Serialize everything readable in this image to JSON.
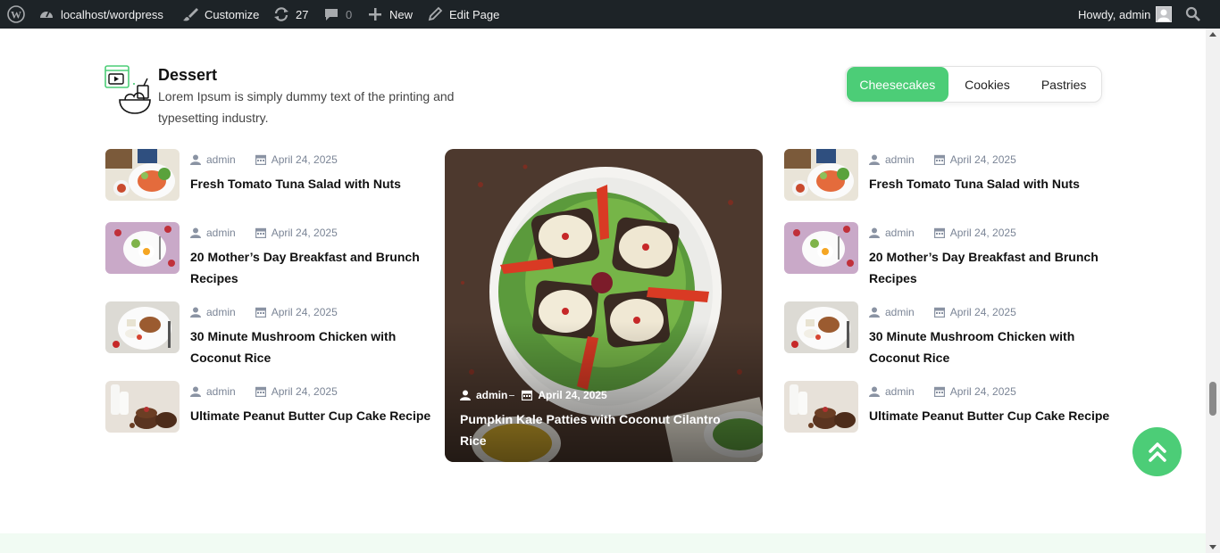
{
  "adminbar": {
    "site": "localhost/wordpress",
    "customize": "Customize",
    "updates": "27",
    "comments": "0",
    "new": "New",
    "edit_page": "Edit Page",
    "howdy": "Howdy, admin"
  },
  "section": {
    "title": "Dessert",
    "description": "Lorem Ipsum is simply dummy text of the printing and typesetting industry."
  },
  "tabs": [
    "Cheesecakes",
    "Cookies",
    "Pastries"
  ],
  "left_posts": [
    {
      "author": "admin",
      "date": "April 24, 2025",
      "title": "Fresh Tomato Tuna Salad with Nuts"
    },
    {
      "author": "admin",
      "date": "April 24, 2025",
      "title": "20 Mother’s Day Breakfast and Brunch Recipes"
    },
    {
      "author": "admin",
      "date": "April 24, 2025",
      "title": "30 Minute Mushroom Chicken with Coconut Rice"
    },
    {
      "author": "admin",
      "date": "April 24, 2025",
      "title": "Ultimate Peanut Butter Cup Cake Recipe"
    }
  ],
  "featured": {
    "author": "admin",
    "date": "April 24, 2025",
    "title": "Pumpkin Kale Patties with Coconut Cilantro Rice"
  },
  "right_posts": [
    {
      "author": "admin",
      "date": "April 24, 2025",
      "title": "Fresh Tomato Tuna Salad with Nuts"
    },
    {
      "author": "admin",
      "date": "April 24, 2025",
      "title": "20 Mother’s Day Breakfast and Brunch Recipes"
    },
    {
      "author": "admin",
      "date": "April 24, 2025",
      "title": "30 Minute Mushroom Chicken with Coconut Rice"
    },
    {
      "author": "admin",
      "date": "April 24, 2025",
      "title": "Ultimate Peanut Butter Cup Cake Recipe"
    }
  ],
  "colors": {
    "accent": "#4ccd77",
    "adminbar": "#1d2327",
    "meta": "#7b8596"
  }
}
